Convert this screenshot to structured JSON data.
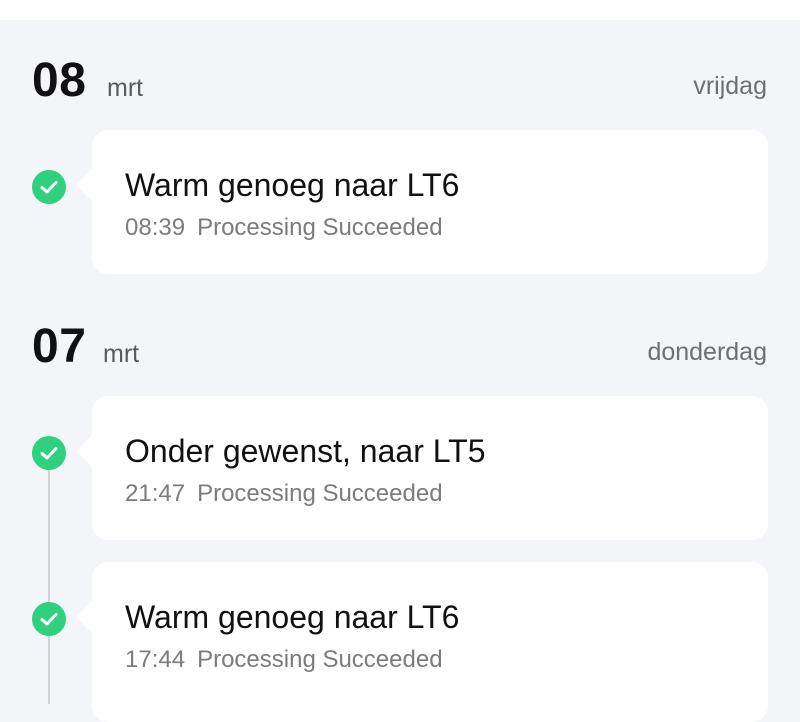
{
  "groups": [
    {
      "day": "08",
      "month": "mrt",
      "weekday": "vrijdag",
      "entries": [
        {
          "title": "Warm genoeg naar LT6",
          "time": "08:39",
          "status": "Processing Succeeded",
          "icon": "check-circle-icon"
        }
      ]
    },
    {
      "day": "07",
      "month": "mrt",
      "weekday": "donderdag",
      "entries": [
        {
          "title": "Onder gewenst, naar LT5",
          "time": "21:47",
          "status": "Processing Succeeded",
          "icon": "check-circle-icon"
        },
        {
          "title": "Warm genoeg naar LT6",
          "time": "17:44",
          "status": "Processing Succeeded",
          "icon": "check-circle-icon"
        }
      ]
    }
  ],
  "colors": {
    "background": "#f4f5f9",
    "card": "#ffffff",
    "success": "#2fd07e",
    "timeline": "#d2d3d8"
  }
}
